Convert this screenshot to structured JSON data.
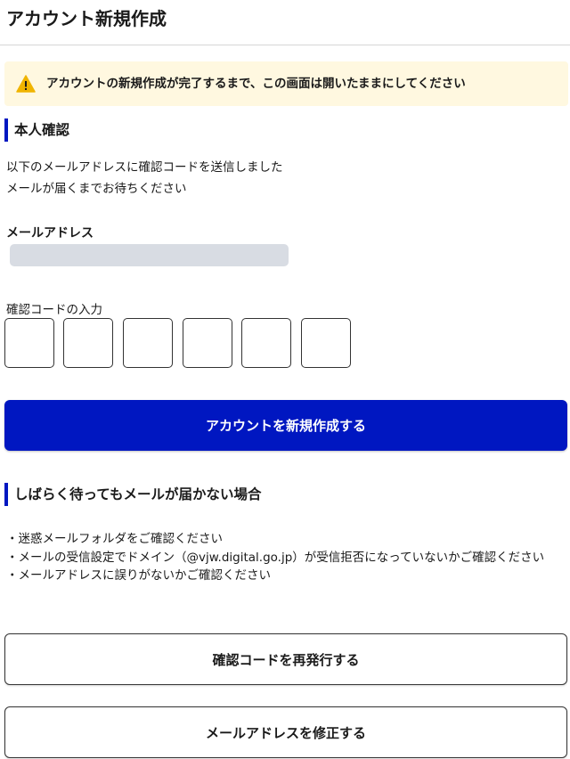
{
  "header": {
    "title": "アカウント新規作成"
  },
  "notice": {
    "icon": "warning-triangle-icon",
    "icon_color": "#f0b400",
    "text": "アカウントの新規作成が完了するまで、この画面は開いたままにしてください"
  },
  "verification": {
    "heading": "本人確認",
    "message_lines": [
      "以下のメールアドレスに確認コードを送信しました",
      "メールが届くまでお待ちください"
    ],
    "email_label": "メールアドレス",
    "code_label": "確認コードの入力",
    "code_digit_count": 6,
    "submit_label": "アカウントを新規作成する"
  },
  "help": {
    "heading": "しばらく待ってもメールが届かない場合",
    "items": [
      "・迷惑メールフォルダをご確認ください",
      "・メールの受信設定でドメイン（@vjw.digital.go.jp）が受信拒否になっていないかご確認ください",
      "・メールアドレスに誤りがないかご確認ください"
    ]
  },
  "actions": {
    "resend_label": "確認コードを再発行する",
    "edit_email_label": "メールアドレスを修正する"
  },
  "colors": {
    "primary": "#0017c1",
    "notice_background": "#fff8e0",
    "masked_value": "#d8dce3"
  }
}
